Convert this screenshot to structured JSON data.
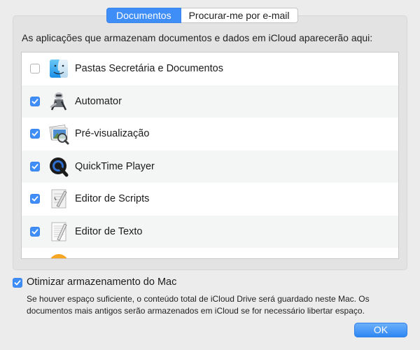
{
  "tabs": [
    {
      "label": "Documentos",
      "active": true
    },
    {
      "label": "Procurar-me por e-mail",
      "active": false
    }
  ],
  "description": "As aplicações que armazenam documentos e dados em iCloud aparecerão aqui:",
  "apps": [
    {
      "label": "Pastas Secretária e Documentos",
      "checked": false,
      "icon": "finder-icon"
    },
    {
      "label": "Automator",
      "checked": true,
      "icon": "automator-icon"
    },
    {
      "label": "Pré-visualização",
      "checked": true,
      "icon": "preview-icon"
    },
    {
      "label": "QuickTime Player",
      "checked": true,
      "icon": "quicktime-icon"
    },
    {
      "label": "Editor de Scripts",
      "checked": true,
      "icon": "script-editor-icon"
    },
    {
      "label": "Editor de Texto",
      "checked": true,
      "icon": "textedit-icon"
    },
    {
      "label": "",
      "checked": true,
      "icon": "ibooks-icon"
    }
  ],
  "optimize": {
    "label": "Otimizar armazenamento do Mac",
    "checked": true,
    "description": "Se houver espaço suficiente, o conteúdo total de iCloud Drive será guardado neste Mac. Os documentos mais antigos serão armazenados em iCloud se for necessário libertar espaço."
  },
  "ok_label": "OK",
  "colors": {
    "accent": "#3f8df6",
    "background": "#ececec"
  }
}
